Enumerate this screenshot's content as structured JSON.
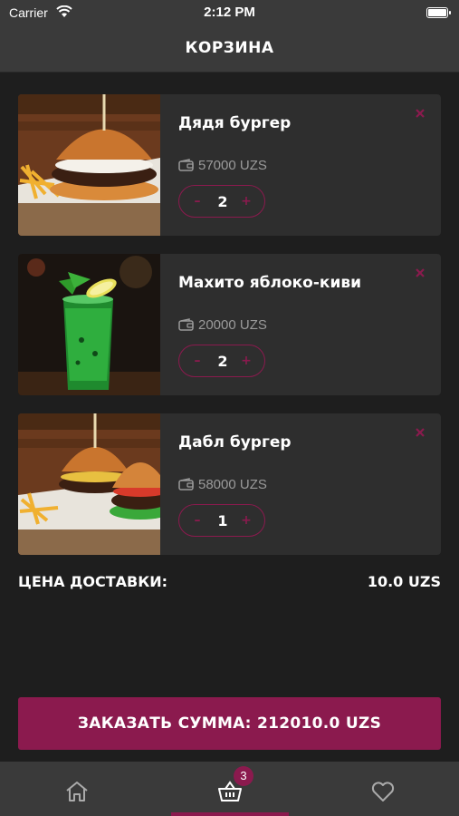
{
  "status_bar": {
    "carrier": "Carrier",
    "time": "2:12 PM"
  },
  "header": {
    "title": "КОРЗИНА"
  },
  "cart": {
    "items": [
      {
        "name": "Дядя бургер",
        "price": "57000 UZS",
        "quantity": "2",
        "minus": "–",
        "plus": "+"
      },
      {
        "name": "Махито яблоко-киви",
        "price": "20000 UZS",
        "quantity": "2",
        "minus": "–",
        "plus": "+"
      },
      {
        "name": "Дабл бургер",
        "price": "58000 UZS",
        "quantity": "1",
        "minus": "–",
        "plus": "+"
      }
    ]
  },
  "delivery": {
    "label": "ЦЕНА ДОСТАВКИ:",
    "value": "10.0 UZS"
  },
  "order_button": {
    "label": "ЗАКАЗАТЬ СУММА: 212010.0 UZS"
  },
  "tab_bar": {
    "active": "cart",
    "cart_badge": "3",
    "tabs": [
      {
        "icon": "home-icon"
      },
      {
        "icon": "basket-icon"
      },
      {
        "icon": "heart-icon"
      }
    ]
  },
  "colors": {
    "accent": "#8b1a4e",
    "background": "#1e1e1e",
    "card": "#2e2e2e",
    "bar": "#3a3a3a",
    "muted_text": "#9a9a9a"
  }
}
